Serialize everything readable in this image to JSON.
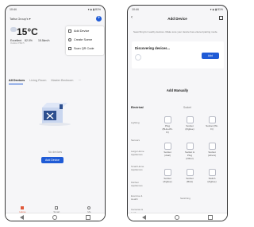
{
  "phone1": {
    "status": {
      "time": "10:44",
      "icons": "▾ ◈ ▮ 81%"
    },
    "home_name": "Tatha Group's ▾",
    "weather": {
      "temp": "15°C",
      "condition": "Excellent",
      "humidity": "82.0%",
      "wind": "15.5km/h",
      "sub_left": "Outdoor PM2.5",
      "sub_mid": "Outdoor Humidity",
      "sub_right": "Outdoor Pressure"
    },
    "menu": [
      {
        "label": "Add Device",
        "icon": "add-device-icon"
      },
      {
        "label": "Create Scene",
        "icon": "scene-icon"
      },
      {
        "label": "Scan QR Code",
        "icon": "qr-code-icon"
      }
    ],
    "tabs": [
      "All Devices",
      "Living Room",
      "Master Bedroom",
      "···"
    ],
    "empty_text": "No devices",
    "add_button": "Add Device",
    "bottom_nav": [
      "Home",
      "Smart",
      "Me"
    ],
    "accent": "#1f5bd6"
  },
  "phone2": {
    "status": {
      "time": "10:44",
      "icons": "▾ ◈ ▮ 81%"
    },
    "title": "Add Device",
    "notice": "Searching for nearby devices. Make sure your device has entered pairing mode.",
    "discovering": "Discovering devices...",
    "discover_button": "Add",
    "add_manually": "Add Manually",
    "col_headers": [
      "Electrical",
      "Socket"
    ],
    "categories": [
      "Lighting",
      "Sensors",
      "Large Home Appliances",
      "Small Home Appliances",
      "Kitchen Appliances",
      "Exercise & Health",
      "Cameras & Lock"
    ],
    "devices": [
      "Plug (BLE+Wi-Fi)",
      "Socket (Zigbee)",
      "Socket (Wi-Fi)",
      "Socket (dual)",
      "Socket & Plug (Other)",
      "Socket (others)",
      "Socket (Zigbee)",
      "Socket (BLE)",
      "Switch (Zigbee)"
    ],
    "extra_label": "Switching"
  }
}
